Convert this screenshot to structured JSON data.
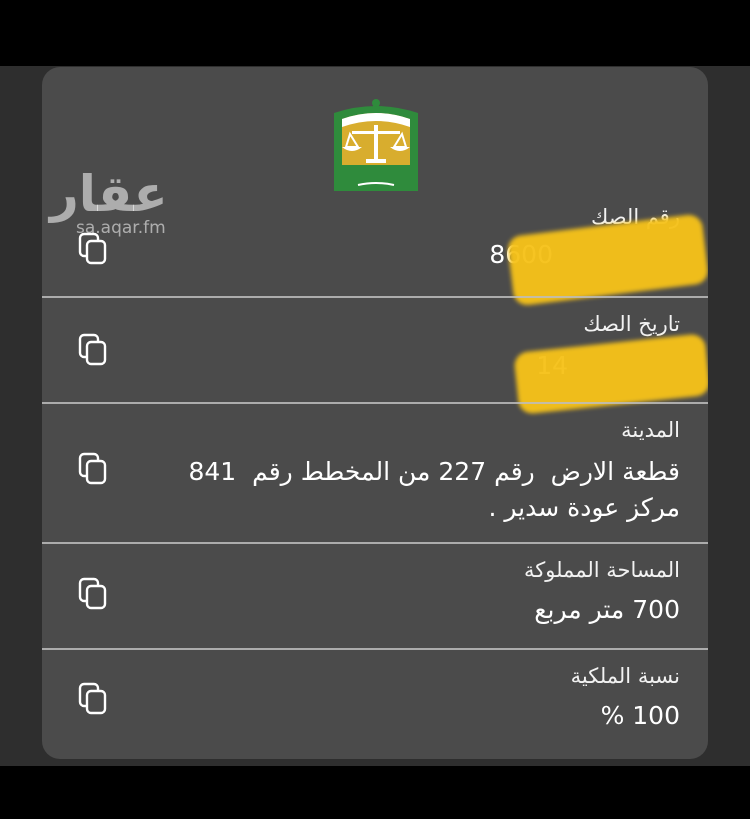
{
  "watermark": {
    "arabic": "عقار",
    "site": "sa.aqar.fm"
  },
  "deed": {
    "logo_icon": "ministry-of-justice-logo",
    "fields": [
      {
        "label": "رقم الصك",
        "value": "8600",
        "copy_icon": "copy-icon"
      },
      {
        "label": "تاريخ الصك",
        "value": "14",
        "copy_icon": "copy-icon"
      },
      {
        "label": "المدينة",
        "value_line1": "قطعة الارض  رقم 227 من المخطط رقم  841",
        "value_line2": "مركز عودة سدير .",
        "copy_icon": "copy-icon"
      },
      {
        "label": "المساحة المملوكة",
        "value": "700 متر مربع",
        "copy_icon": "copy-icon"
      },
      {
        "label": "نسبة الملكية",
        "value": "100 %",
        "copy_icon": "copy-icon"
      }
    ]
  },
  "colors": {
    "card": "#4b4b4b",
    "background": "#2e2e2e",
    "redaction": "#f6c21a",
    "logo_green": "#2f8b3c",
    "logo_gold": "#d8ad2e"
  }
}
